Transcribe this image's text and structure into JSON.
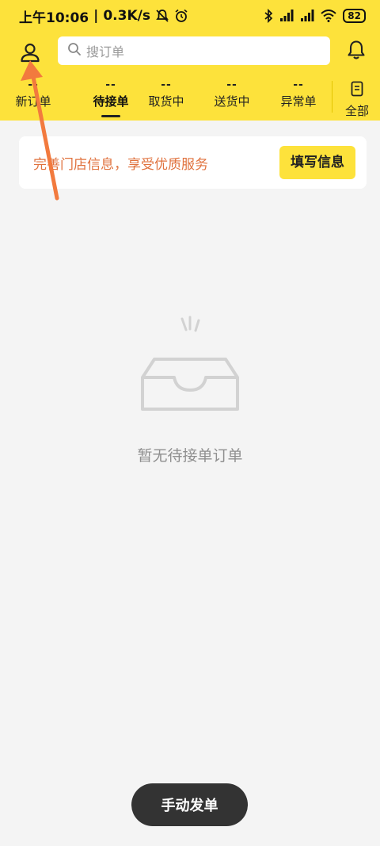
{
  "status_bar": {
    "time": "上午10:06",
    "separator": "|",
    "net_speed": "0.3K/s",
    "battery": "82",
    "icons": [
      "mute-icon",
      "alarm-icon",
      "bluetooth-icon",
      "signal-icon",
      "signal-icon",
      "wifi-icon",
      "battery-icon"
    ]
  },
  "header": {
    "profile_icon": "user-icon",
    "search": {
      "placeholder": "搜订单",
      "icon": "search-icon"
    },
    "bell_icon": "bell-icon"
  },
  "tabs": [
    {
      "count": "--",
      "label": "新订单",
      "active": false
    },
    {
      "count": "--",
      "label": "待接单",
      "active": true
    },
    {
      "count": "--",
      "label": "取货中",
      "active": false
    },
    {
      "count": "--",
      "label": "送货中",
      "active": false
    },
    {
      "count": "--",
      "label": "异常单",
      "active": false
    }
  ],
  "tab_all": {
    "label": "全部",
    "icon": "document-icon"
  },
  "banner": {
    "text": "完善门店信息，享受优质服务",
    "button": "填写信息"
  },
  "empty_state": {
    "icon": "empty-inbox-icon",
    "text": "暂无待接单订单"
  },
  "bottom_button": {
    "label": "手动发单"
  },
  "colors": {
    "brand_yellow": "#fde23b",
    "banner_text": "#e0723e",
    "arrow": "#f27a3e",
    "background": "#f4f4f4"
  }
}
